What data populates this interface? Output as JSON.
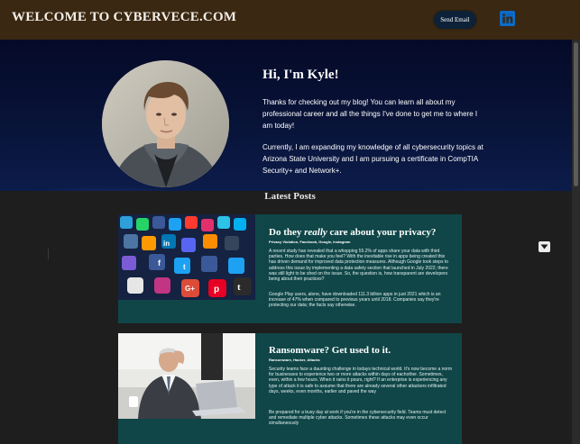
{
  "header": {
    "title": "WELCOME TO CYBERVECE.COM",
    "email_label": "Send Email",
    "linkedin_icon": "linkedin-icon",
    "linkedin_color": "#0a66c2"
  },
  "hero": {
    "heading": "Hi, I'm Kyle!",
    "paragraph1": "Thanks for checking out my blog! You can learn all about my professional career and all the things I've done to get me to where I am today!",
    "paragraph2": "Currently, I am expanding my knowledge of all cybersecurity topics at Arizona State University and I am pursuing a certificate in CompTIA Security+ and Network+."
  },
  "latest": {
    "heading": "Latest Posts"
  },
  "posts": [
    {
      "title_pre": "Do they ",
      "title_em": "really",
      "title_post": " care about your privacy?",
      "tags": "Privacy Violation, Facebook, Google, Instagram",
      "paragraph1": "A recent study has revealed that a whopping 55.2% of apps share your data with third parties. How does that make you feel? With the inevitable rise in apps being created this has driven demand for improved data protection measures. Although Google took steps to address this issue by implementing a data safety section that launched in July 2022; there was still light to be shed on the issue. So, the question is, how transparent are developers being about their practices?",
      "paragraph2": "Google Play users, alone, have downloaded 111.3 billion apps in just 2021 which is an increase of 47% when compared to previous years until 2018. Companies say they're protecting our data; the facts say otherwise.",
      "image_icon": "social-media-apps-image"
    },
    {
      "title": "Ransomware? Get used to it.",
      "tags": "Ransomware, Hacker, Attacks",
      "paragraph1": "Security teams face a daunting challenge in todays technical world. It's now become a norm for businesses to experience two or more attacks within days of eachother. Sometimes, even, within a few hours. When it rains it pours, right? If an enterprise is experiencing any type of attack it is safe to assume that there are already several other attackers infiltrated days, weeks, even months, earlier and paved the way",
      "paragraph2": "Be prepared for a busy day at work if you're in the cybersecurity field. Teams must detect and remediate multiple cyber attacks. Sometimes these attacks may even occur simultaneously",
      "image_icon": "stressed-man-at-laptop-image"
    }
  ],
  "social_apps": [
    "Facebook",
    "Twitter",
    "LinkedIn",
    "Google+",
    "Instagram",
    "Pinterest",
    "Tumblr",
    "WhatsApp",
    "YouTube",
    "Messenger"
  ]
}
